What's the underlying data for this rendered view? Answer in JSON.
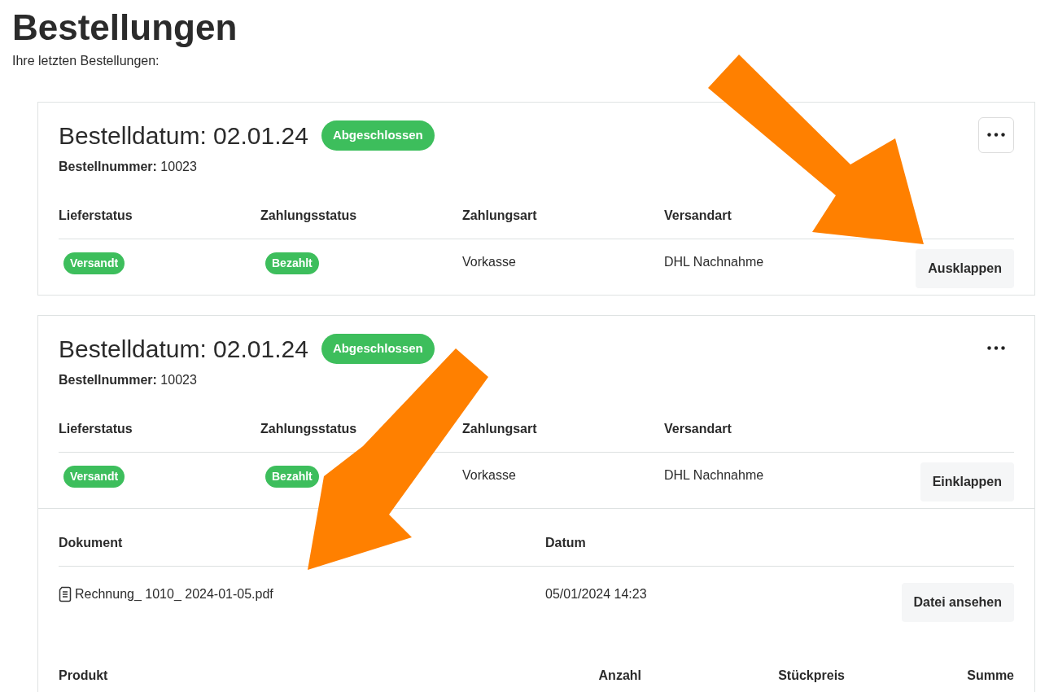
{
  "page": {
    "title": "Bestellungen",
    "subtitle": "Ihre letzten Bestellungen:"
  },
  "orders": [
    {
      "date_label": "Bestelldatum: 02.01.24",
      "status": "Abgeschlossen",
      "number_label": "Bestellnummer:",
      "number": "10023",
      "menu_highlighted": true,
      "columns": [
        "Lieferstatus",
        "Zahlungsstatus",
        "Zahlungsart",
        "Versandart"
      ],
      "values": [
        {
          "kind": "badge",
          "text": "Versandt"
        },
        {
          "kind": "badge",
          "text": "Bezahlt"
        },
        {
          "kind": "text",
          "text": "Vorkasse"
        },
        {
          "kind": "text",
          "text": "DHL Nachnahme"
        }
      ],
      "toggle_button": "Ausklappen",
      "expanded": false
    },
    {
      "date_label": "Bestelldatum: 02.01.24",
      "status": "Abgeschlossen",
      "number_label": "Bestellnummer:",
      "number": "10023",
      "menu_highlighted": false,
      "columns": [
        "Lieferstatus",
        "Zahlungsstatus",
        "Zahlungsart",
        "Versandart"
      ],
      "values": [
        {
          "kind": "badge",
          "text": "Versandt"
        },
        {
          "kind": "badge",
          "text": "Bezahlt"
        },
        {
          "kind": "text",
          "text": "Vorkasse"
        },
        {
          "kind": "text",
          "text": "DHL Nachnahme"
        }
      ],
      "toggle_button": "Einklappen",
      "expanded": true,
      "documents": {
        "columns": [
          "Dokument",
          "Datum"
        ],
        "rows": [
          {
            "name": "Rechnung_ 1010_ 2024-01-05.pdf",
            "date": "05/01/2024 14:23",
            "button": "Datei ansehen"
          }
        ]
      },
      "products": {
        "columns": [
          "Produkt",
          "Anzahl",
          "Stückpreis",
          "Summe"
        ]
      }
    }
  ]
}
